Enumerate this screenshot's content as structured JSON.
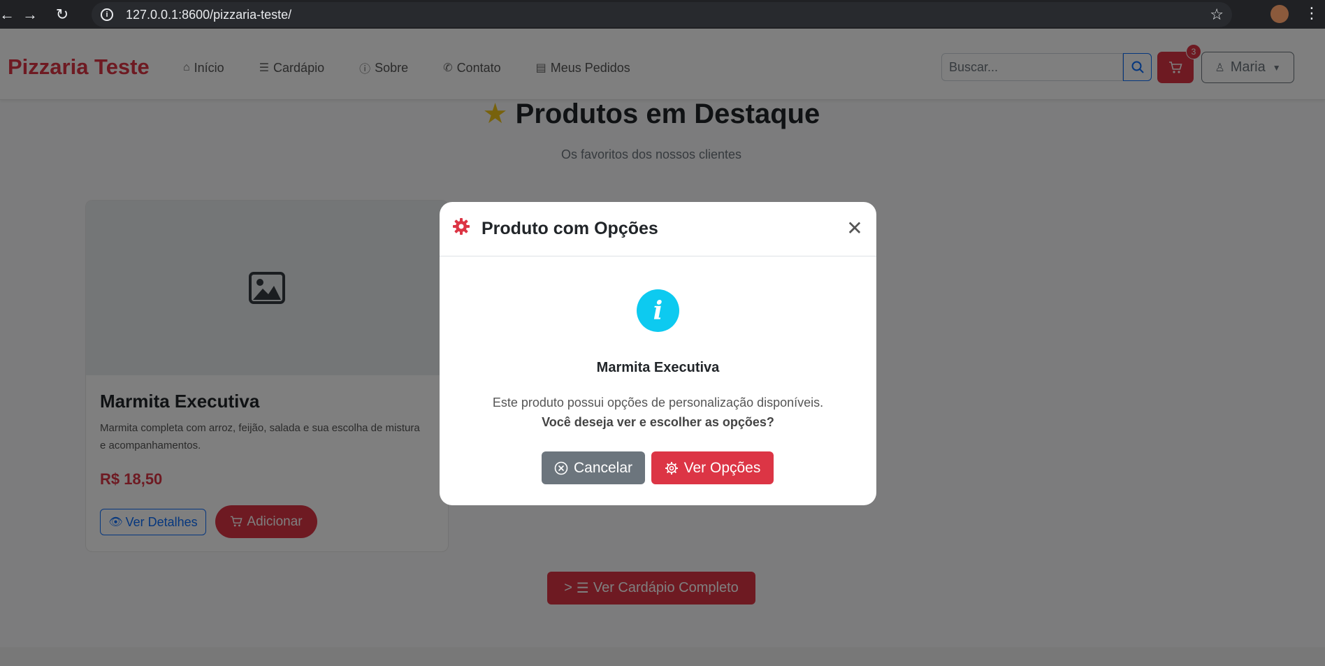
{
  "browser": {
    "url": "127.0.0.1:8600/pizzaria-teste/"
  },
  "navbar": {
    "brand": "Pizzaria Teste",
    "links": [
      {
        "label": "Início",
        "icon": "home-icon"
      },
      {
        "label": "Cardápio",
        "icon": "menu-icon"
      },
      {
        "label": "Sobre",
        "icon": "info-icon"
      },
      {
        "label": "Contato",
        "icon": "phone-icon"
      },
      {
        "label": "Meus Pedidos",
        "icon": "receipt-icon"
      }
    ],
    "search_placeholder": "Buscar...",
    "cart_count": "3",
    "user_name": "Maria"
  },
  "featured": {
    "title": "Produtos em Destaque",
    "subtitle": "Os favoritos dos nossos clientes",
    "product": {
      "name": "Marmita Executiva",
      "description": "Marmita completa com arroz, feijão, salada e sua escolha de mistura e acompanhamentos.",
      "price": "R$ 18,50",
      "details_label": "Ver Detalhes",
      "add_label": "Adicionar"
    },
    "full_menu_prefix": ">",
    "full_menu_label": "Ver Cardápio Completo"
  },
  "modal": {
    "title": "Produto com Opções",
    "product_name": "Marmita Executiva",
    "message": "Este produto possui opções de personalização disponíveis.",
    "question": "Você deseja ver e escolher as opções?",
    "cancel_label": "Cancelar",
    "confirm_label": "Ver Opções"
  },
  "colors": {
    "brand": "#dc3545",
    "primary": "#0d6efd",
    "info": "#0dcaf0",
    "secondary": "#6c757d"
  }
}
